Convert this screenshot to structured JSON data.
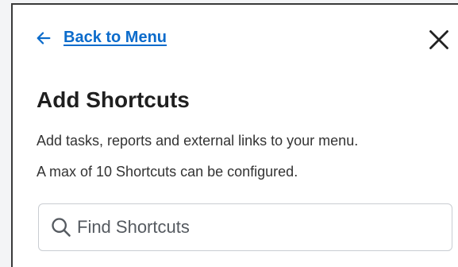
{
  "nav": {
    "back_label": "Back to Menu"
  },
  "heading": {
    "title": "Add Shortcuts",
    "description_line1": "Add tasks, reports and external links to your menu.",
    "description_line2": "A max of 10 Shortcuts can be configured."
  },
  "search": {
    "placeholder": "Find Shortcuts",
    "value": ""
  },
  "icons": {
    "back": "arrow-left-icon",
    "close": "close-icon",
    "search": "search-icon"
  },
  "colors": {
    "link": "#0b6bcb",
    "title": "#1f1f1f",
    "text": "#333333",
    "border": "#c9cdd2"
  }
}
